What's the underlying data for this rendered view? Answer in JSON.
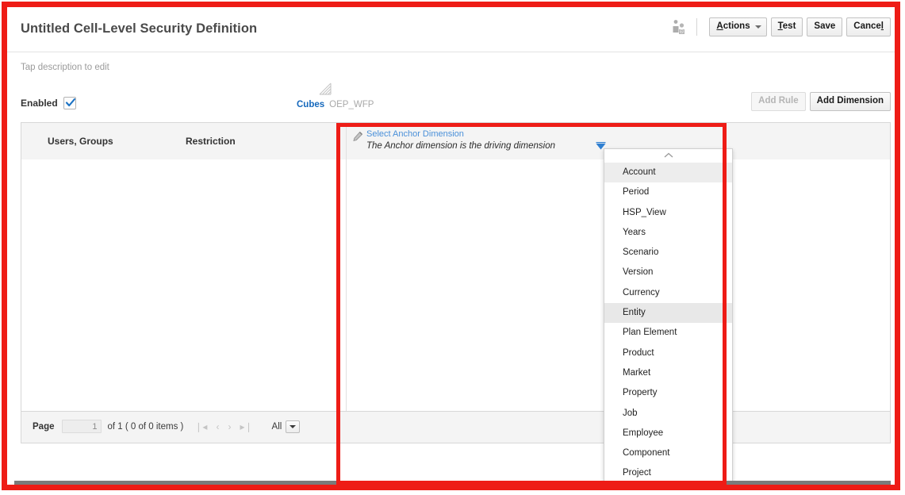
{
  "header": {
    "title": "Untitled Cell-Level Security Definition",
    "people_icon": "users-icon",
    "actions_label": "Actions",
    "actions_accesskey": "A",
    "test_label": "est",
    "test_accesskey": "T",
    "save_label": "Save",
    "cancel_label": "Cance",
    "cancel_accesskey": "l"
  },
  "description": {
    "placeholder": "Tap description to edit"
  },
  "meta": {
    "enabled_label": "Enabled",
    "enabled_checked": true,
    "cubes_label": "Cubes",
    "cubes_value": "OEP_WFP",
    "cubes_icon": "cube-grid-icon",
    "add_rule_label": "Add Rule",
    "add_rule_disabled": true,
    "add_dimension_label": "Add Dimension"
  },
  "table": {
    "columns": [
      {
        "label": "Users, Groups"
      },
      {
        "label": "Restriction"
      }
    ],
    "anchor": {
      "icon": "pencil-edit-icon",
      "link_label": "Select Anchor Dimension",
      "hint": "The Anchor dimension is the driving dimension",
      "dropdown_arrow_icon": "dropdown-arrow-icon"
    },
    "rows": [],
    "pager": {
      "page_label": "Page",
      "page_value": "1",
      "of_text": "of 1 ( 0 of 0 items )",
      "first_icon": "❘◂",
      "prev_icon": "‹",
      "next_icon": "›",
      "last_icon": "▸❘",
      "rows_label": "All"
    }
  },
  "dropdown": {
    "scroll_up_icon": "chevron-up-icon",
    "scroll_down_icon": "chevron-down-icon",
    "highlighted": "Entity",
    "items": [
      {
        "label": "Account",
        "state": "separator"
      },
      {
        "label": "Period",
        "state": "normal"
      },
      {
        "label": "HSP_View",
        "state": "normal"
      },
      {
        "label": "Years",
        "state": "normal"
      },
      {
        "label": "Scenario",
        "state": "normal"
      },
      {
        "label": "Version",
        "state": "normal"
      },
      {
        "label": "Currency",
        "state": "normal"
      },
      {
        "label": "Entity",
        "state": "highlighted"
      },
      {
        "label": "Plan Element",
        "state": "normal"
      },
      {
        "label": "Product",
        "state": "normal"
      },
      {
        "label": "Market",
        "state": "normal"
      },
      {
        "label": "Property",
        "state": "normal"
      },
      {
        "label": "Job",
        "state": "normal"
      },
      {
        "label": "Employee",
        "state": "normal"
      },
      {
        "label": "Component",
        "state": "normal"
      },
      {
        "label": "Project",
        "state": "normal"
      }
    ]
  },
  "colors": {
    "annotation_red": "#ee1c16",
    "link_blue": "#4a90d9",
    "cubes_blue": "#1568bc",
    "highlight_grey": "#e8e8e8"
  }
}
